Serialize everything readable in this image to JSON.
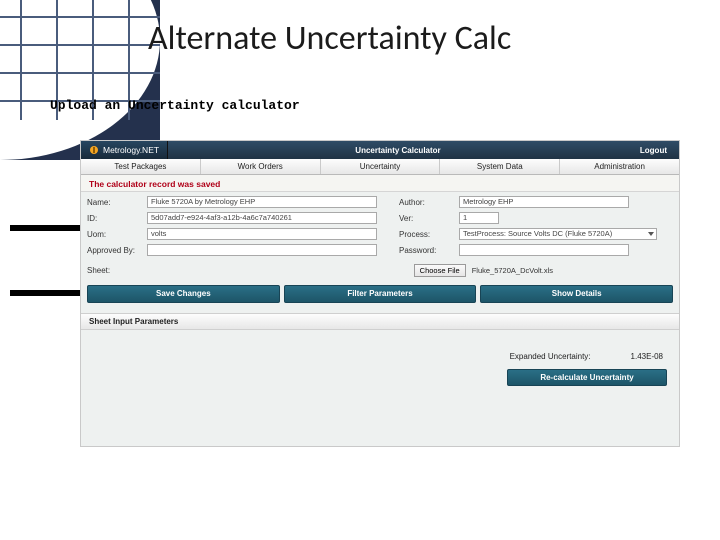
{
  "slide": {
    "title": "Alternate Uncertainty Calc",
    "subtitle": "Upload an Uncertainty calculator"
  },
  "topbar": {
    "brand": "Metrology.NET",
    "center": "Uncertainty Calculator",
    "logout": "Logout"
  },
  "nav": {
    "tab1": "Test Packages",
    "tab2": "Work Orders",
    "tab3": "Uncertainty",
    "tab4": "System Data",
    "tab5": "Administration"
  },
  "saved_msg": "The calculator record was saved",
  "form": {
    "name_label": "Name:",
    "name_value": "Fluke 5720A by Metrology EHP",
    "author_label": "Author:",
    "author_value": "Metrology EHP",
    "id_label": "ID:",
    "id_value": "5d07add7-e924-4af3-a12b-4a6c7a740261",
    "ver_label": "Ver:",
    "ver_value": "1",
    "uom_label": "Uom:",
    "uom_value": "volts",
    "process_label": "Process:",
    "process_value": "TestProcess: Source Volts DC (Fluke 5720A)",
    "approvedby_label": "Approved By:",
    "approvedby_value": "",
    "password_label": "Password:",
    "password_value": "",
    "sheet_label": "Sheet:",
    "choose_file": "Choose File",
    "file_name": "Fluke_5720A_DcVolt.xls"
  },
  "buttons": {
    "save": "Save Changes",
    "filter": "Filter Parameters",
    "details": "Show Details",
    "recalc": "Re-calculate Uncertainty"
  },
  "section": {
    "sheet_params": "Sheet Input Parameters"
  },
  "results": {
    "exp_label": "Expanded Uncertainty:",
    "exp_value": "1.43E-08"
  }
}
